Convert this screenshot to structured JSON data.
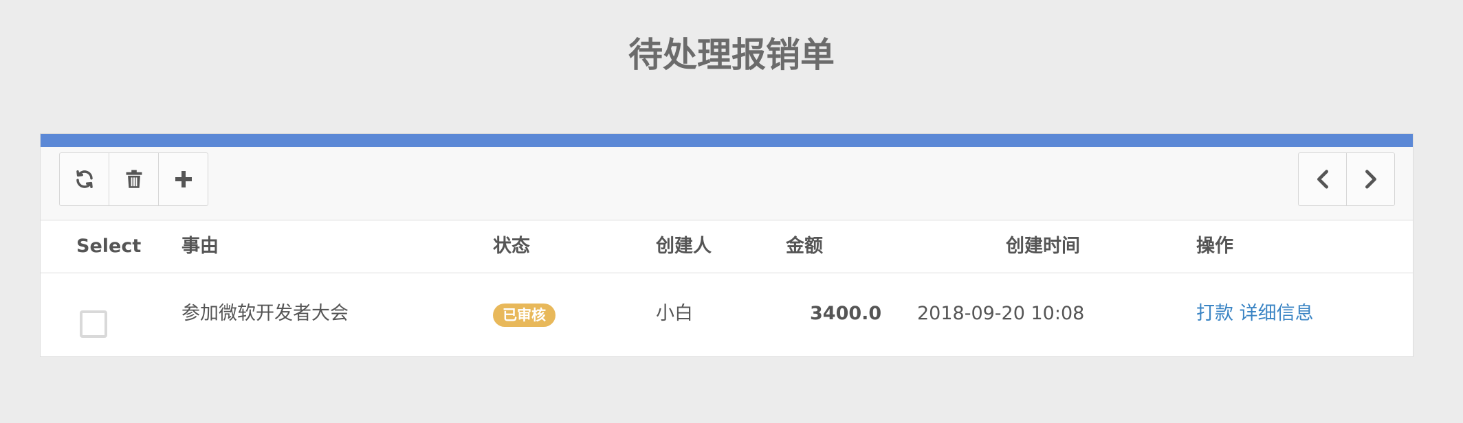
{
  "page": {
    "title": "待处理报销单"
  },
  "toolbar": {
    "left_buttons": [
      "refresh-icon",
      "trash-icon",
      "plus-icon"
    ],
    "right_buttons": [
      "chevron-left-icon",
      "chevron-right-icon"
    ]
  },
  "table": {
    "headers": {
      "select": "Select",
      "reason": "事由",
      "status": "状态",
      "creator": "创建人",
      "amount": "金额",
      "created_at": "创建时间",
      "actions": "操作"
    },
    "rows": [
      {
        "checked": false,
        "reason": "参加微软开发者大会",
        "status": "已审核",
        "creator": "小白",
        "amount": "3400.0",
        "created_at": "2018-09-20 10:08",
        "actions": {
          "pay": "打款",
          "detail": "详细信息"
        }
      }
    ]
  },
  "colors": {
    "accent": "#5b88d6",
    "badge": "#e8b85a",
    "link": "#3a84c4"
  }
}
